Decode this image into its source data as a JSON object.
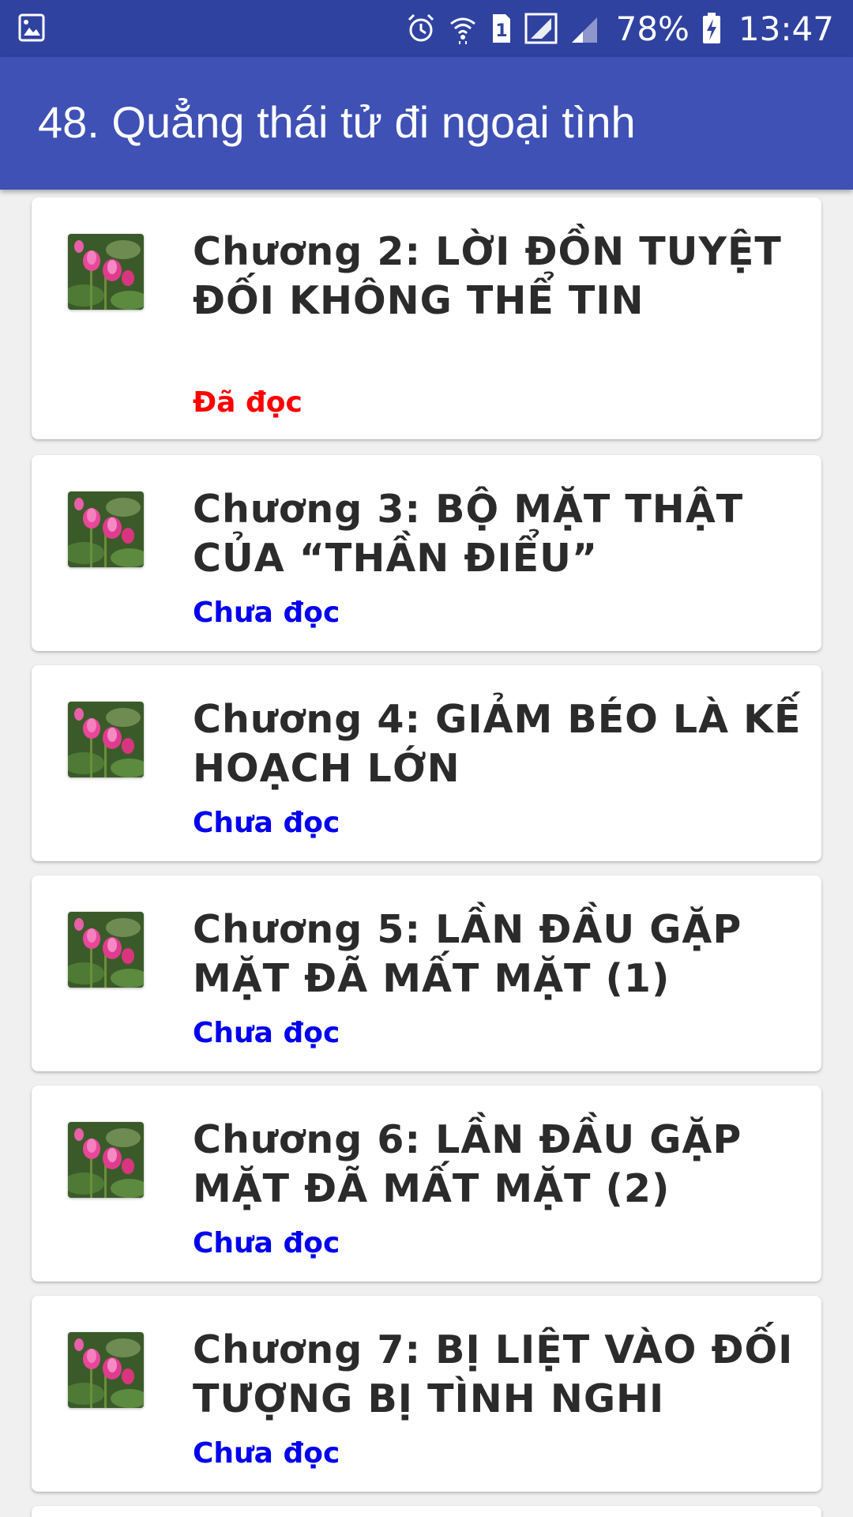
{
  "status_bar": {
    "battery_percent": "78%",
    "time": "13:47",
    "sim_slot": "1",
    "icons": [
      "gallery-icon",
      "alarm-icon",
      "wifi-icon",
      "sim-1-icon",
      "signal-icon",
      "signal-weak-icon",
      "battery-charging-icon"
    ]
  },
  "app_bar": {
    "title": "48. Quẳng thái tử đi ngoại tình"
  },
  "colors": {
    "status_bar": "#3042a0",
    "app_bar": "#3f51b5",
    "read": "#ff0000",
    "unread": "#0000ee"
  },
  "chapters": [
    {
      "title": "Chương 2: LỜI ĐỒN TUYỆT ĐỐI KHÔNG THỂ TIN",
      "status": "Đã đọc",
      "read": true
    },
    {
      "title": "Chương 3: BỘ MẶT THẬT CỦA “THẦN ĐIỂU”",
      "status": "Chưa đọc",
      "read": false
    },
    {
      "title": "Chương 4: GIẢM BÉO LÀ KẾ HOẠCH LỚN",
      "status": "Chưa đọc",
      "read": false
    },
    {
      "title": "Chương 5: LẦN ĐẦU GẶP MẶT ĐÃ MẤT MẶT (1)",
      "status": "Chưa đọc",
      "read": false
    },
    {
      "title": "Chương 6: LẦN ĐẦU GẶP MẶT ĐÃ MẤT MẶT (2)",
      "status": "Chưa đọc",
      "read": false
    },
    {
      "title": "Chương 7: BỊ LIỆT VÀO ĐỐI TƯỢNG BỊ TÌNH NGHI",
      "status": "Chưa đọc",
      "read": false
    }
  ]
}
